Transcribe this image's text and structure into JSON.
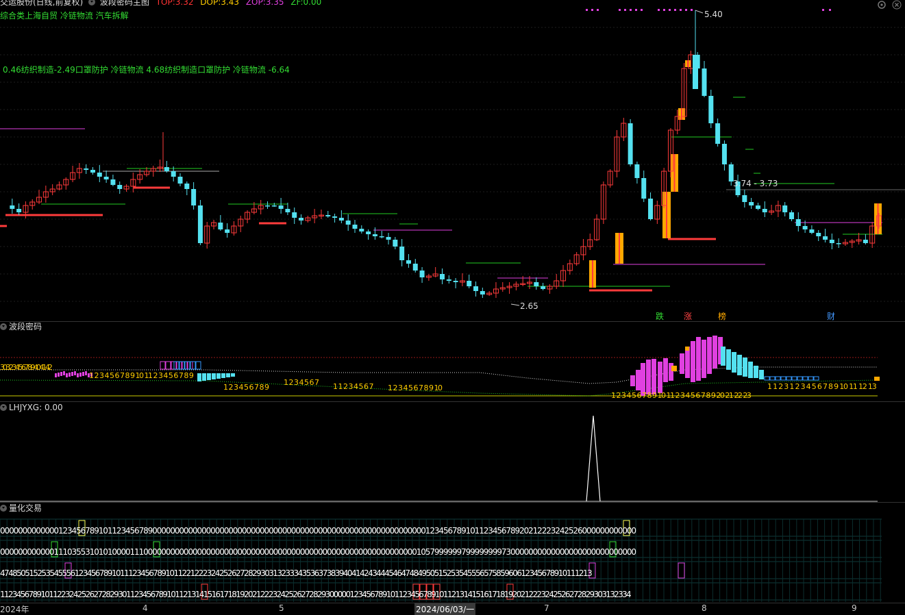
{
  "header": {
    "stock": "交运股份(日线,前复权)",
    "indicator": "波段密码主图",
    "top_label": "TOP:",
    "top_value": "3.32",
    "dop_label": "DOP:",
    "dop_value": "3.43",
    "zop_label": "ZOP:",
    "zop_value": "3.35",
    "zf_label": "ZF:",
    "zf_value": "0.00"
  },
  "sector_line": "综合类上海自贸 冷链物流 汽车拆解",
  "perf_line": "0.46纺织制造-2.49口罩防护 冷链物流 4.68纺织制造口罩防护 冷链物流 -6.64",
  "price_labels": {
    "high": "5.40",
    "low": "2.65",
    "range": "3.74 - 3.73"
  },
  "event_markers": [
    {
      "text": "跌",
      "color": "#33dd33"
    },
    {
      "text": "涨",
      "color": "#ff4444"
    },
    {
      "text": "榜",
      "color": "#ffaa00"
    },
    {
      "text": "财",
      "color": "#4499ff"
    }
  ],
  "panels": {
    "p1_title": "波段密码",
    "p2_title": "LHJYXG",
    "p2_value": ": 0.00",
    "p3_title": "量化交易"
  },
  "panel1_counts": {
    "a": "1 2 3 4 5 6 7 8 9 10 11 2 3 4 5 6 7 8 9",
    "b": "1 2 3 4 5 6 7 8 9",
    "c": "1 2 3 4 5 6 7",
    "d": "1 1 2 3 4 5 6 7",
    "e": "1 2 3 4 5 6 7 8 9 10",
    "f": "1 2 3 4 5 6 7 8 9 10 11 2 3 4 5 6 7 8 9 20 21 22 23",
    "g": "1 1 2 3 1 2 3 4 5 6 7 8 9 10 11 12 13",
    "left": "30 3 2 3 4 5 6 7 8 9 40 41 42"
  },
  "quant_rows": [
    "0000000000000123456789101123456789000000000000000000000000000000000000000000000000000000000000012345678910112345678920212223242526000000000000",
    "0000000000001110355310101000011100000000000000000000000000000000000000000000000000000000000001057999999799999999730000000000000000000000000000",
    "47485051525354555612345678910111234567891011221222324252627282930313233343536373839404142434445464748495051525354555657585960612345678910111213",
    "11234567891011223242526272829301123456789101121314151617181920212223242526272829300000123456789101123456789101121314151617181920212223242526272829303132334"
  ],
  "x_axis": {
    "year": "2024年",
    "m4": "4",
    "m5": "5",
    "cursor_date": "2024/06/03/一",
    "m7": "7",
    "m8": "8",
    "m9": "9"
  },
  "colors": {
    "up": "#ff3b3b",
    "down": "#54e1f0",
    "magenta": "#e040e0",
    "orange": "#ffa800",
    "green": "#22cc22"
  }
}
